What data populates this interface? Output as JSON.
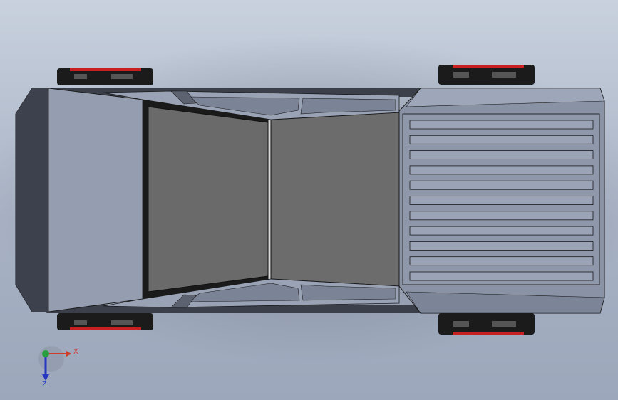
{
  "view": {
    "background_top": "#c9d1de",
    "background_bottom": "#9ca7bb"
  },
  "model": {
    "body_color": "#8c95a8",
    "cabin_floor_color": "#6c6c6c",
    "bed_color": "#8a93a6",
    "wheel_accent_color": "#c82020",
    "edge_color": "#1a1a1a",
    "bed_slat_count": 11
  },
  "triad": {
    "x_label": "X",
    "z_label": "Z",
    "x_color": "#d23a2a",
    "y_color": "#2aa040",
    "z_color": "#2838c0"
  }
}
